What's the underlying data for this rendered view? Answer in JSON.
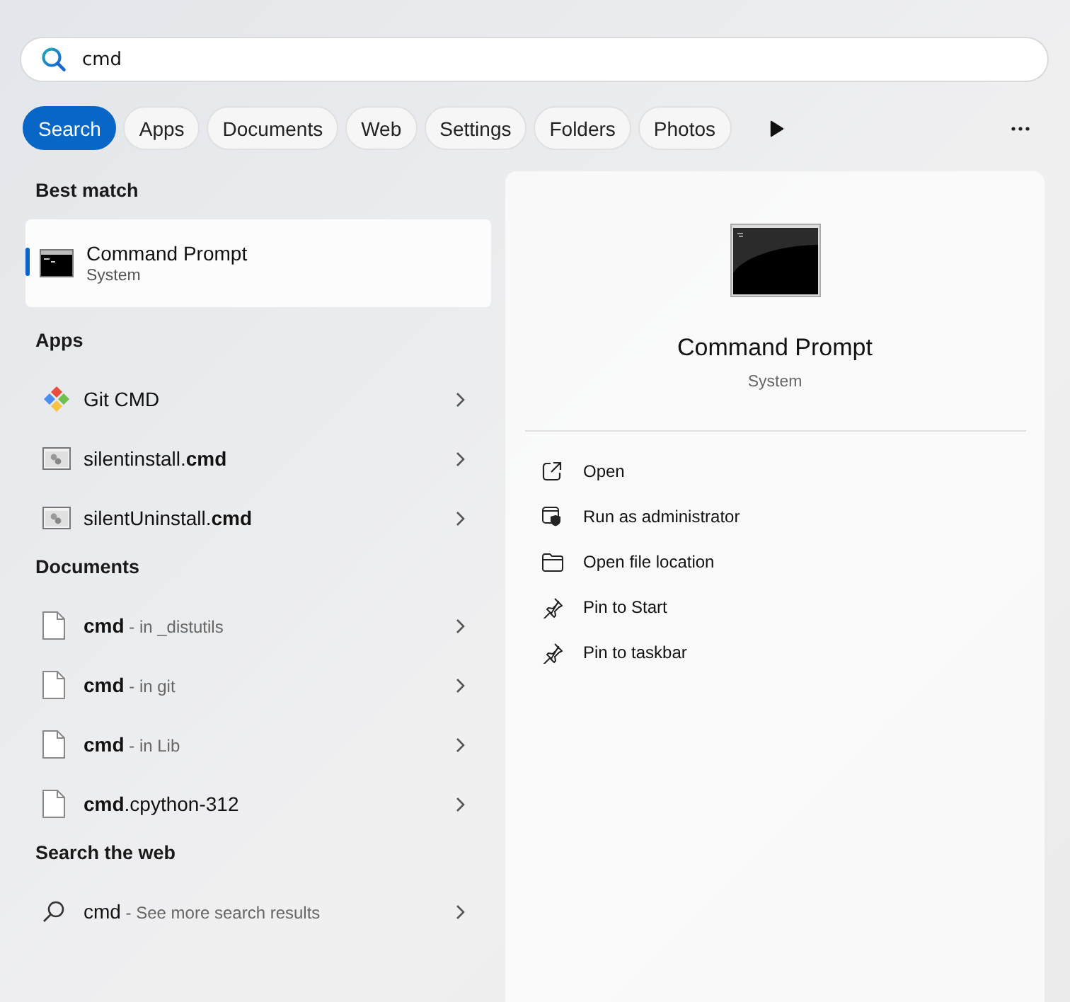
{
  "search": {
    "value": "cmd"
  },
  "filters": [
    {
      "label": "Search",
      "selected": true
    },
    {
      "label": "Apps",
      "selected": false
    },
    {
      "label": "Documents",
      "selected": false
    },
    {
      "label": "Web",
      "selected": false
    },
    {
      "label": "Settings",
      "selected": false
    },
    {
      "label": "Folders",
      "selected": false
    },
    {
      "label": "Photos",
      "selected": false
    }
  ],
  "best_match": {
    "heading": "Best match",
    "title": "Command Prompt",
    "subtitle": "System",
    "selected": true
  },
  "sections": [
    {
      "heading": "Apps",
      "items": [
        {
          "kind": "git",
          "title": "Git CMD"
        },
        {
          "kind": "script",
          "title": "silentinstall.**cmd**"
        },
        {
          "kind": "script",
          "title": "silentUninstall.**cmd**"
        }
      ]
    },
    {
      "heading": "Documents",
      "items": [
        {
          "kind": "doc",
          "title": "**cmd**",
          "detail": " - in _distutils"
        },
        {
          "kind": "doc",
          "title": "**cmd**",
          "detail": " - in git"
        },
        {
          "kind": "doc",
          "title": "**cmd**",
          "detail": " - in Lib"
        },
        {
          "kind": "doc",
          "title": "**cmd**.cpython-312"
        }
      ]
    },
    {
      "heading": "Search the web",
      "items": [
        {
          "kind": "web",
          "title": "cmd",
          "detail": " - See more search results"
        }
      ]
    }
  ],
  "preview": {
    "title": "Command Prompt",
    "subtitle": "System",
    "actions": [
      {
        "kind": "open",
        "label": "Open"
      },
      {
        "kind": "admin",
        "label": "Run as administrator"
      },
      {
        "kind": "folder",
        "label": "Open file location"
      },
      {
        "kind": "pin",
        "label": "Pin to Start"
      },
      {
        "kind": "pin",
        "label": "Pin to taskbar"
      }
    ]
  }
}
